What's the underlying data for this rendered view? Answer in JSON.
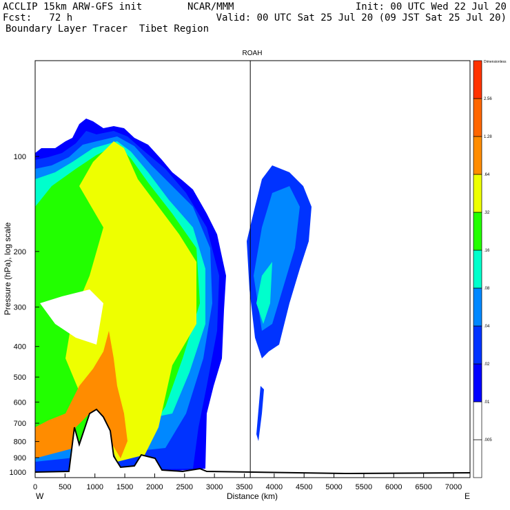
{
  "header": {
    "model": "ACCLIP 15km ARW-GFS init",
    "org": "NCAR/MMM",
    "init": "Init: 00 UTC Wed 22 Jul 20",
    "fcst": "Fcst:   72 h",
    "valid": "Valid: 00 UTC Sat 25 Jul 20 (09 JST Sat 25 Jul 20)",
    "field": "Boundary Layer Tracer  Tibet Region"
  },
  "chart_data": {
    "type": "heatmap",
    "title": "ROAH",
    "xlabel": "Distance (km)",
    "ylabel": "Pressure (hPa), log scale",
    "x_ticks": [
      0,
      500,
      1000,
      1500,
      2000,
      2500,
      3000,
      3500,
      4000,
      4500,
      5000,
      5500,
      6000,
      6500,
      7000
    ],
    "y_ticks": [
      100,
      200,
      300,
      400,
      500,
      600,
      700,
      800,
      900,
      1000
    ],
    "xlim": [
      0,
      7280
    ],
    "ylim": [
      1020,
      45
    ],
    "x_left_label": "W",
    "x_right_label": "E",
    "marker_line_km": 3600,
    "colorbar": {
      "units": "Dimensionless",
      "levels": [
        ".005",
        ".01",
        ".02",
        ".04",
        ".08",
        ".16",
        ".32",
        ".64",
        "1.28",
        "2.56"
      ],
      "colors": [
        "#ffffff",
        "#ffffff",
        "#0000ff",
        "#0033ff",
        "#0088ff",
        "#00ffcc",
        "#22ff00",
        "#eeff00",
        "#ff8c00",
        "#ff6600",
        "#ff3300"
      ]
    }
  }
}
